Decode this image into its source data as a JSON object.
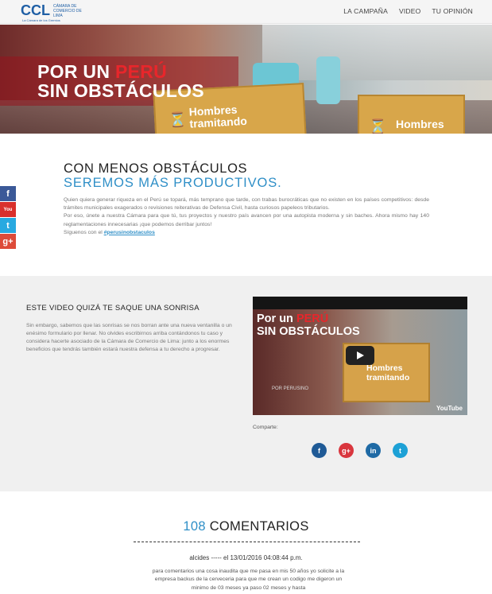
{
  "header": {
    "logo_text": "CCL",
    "logo_org": "CÁMARA DE COMERCIO DE LIMA",
    "logo_tagline": "La Cámara de los Gremios",
    "nav": [
      {
        "label": "LA CAMPAÑA"
      },
      {
        "label": "VIDEO"
      },
      {
        "label": "TU OPINIÓN"
      }
    ]
  },
  "hero": {
    "title_line1_prefix": "POR UN ",
    "title_line1_highlight": "PERÚ",
    "title_line2": "SIN OBSTÁCULOS",
    "sign_left": "Hombres tramitando",
    "sign_right": "Hombres"
  },
  "social_sidebar": [
    {
      "name": "facebook",
      "glyph": "f",
      "color": "#3b5998"
    },
    {
      "name": "youtube",
      "glyph": "You",
      "color": "#d9302c"
    },
    {
      "name": "twitter",
      "glyph": "t",
      "color": "#28a9e0"
    },
    {
      "name": "google-plus",
      "glyph": "g+",
      "color": "#dd4b39"
    }
  ],
  "intro": {
    "heading_line1": "CON MENOS OBSTÁCULOS",
    "heading_line2": "SEREMOS MÁS PRODUCTIVOS.",
    "paragraph1": "Quien quiera generar riqueza en el Perú se topará, más temprano que tarde, con trabas burocráticas que no existen en los países competitivos: desde trámites municipales exagerados o revisiones reiterativas de Defensa Civil, hasta curiosos papeleos tributarios.",
    "paragraph2": "Por eso, únete a nuestra Cámara para que tú, tus proyectos y nuestro país avancen por una autopista moderna y sin baches. Ahora mismo hay 140 reglamentaciones innecesarias ¡que podemos derribar juntos!",
    "follow_prefix": "Síguenos con el ",
    "hashtag": "#perusinobstaculos"
  },
  "video_section": {
    "heading": "ESTE VIDEO QUIZÁ TE SAQUE UNA SONRISA",
    "description": "Sin embargo, sabemos que las sonrisas se nos borran ante una nueva ventanilla o un enésimo formulario por llenar. No olvides escribirnos arriba contándonos tu caso y considera hacerte asociado de la Cámara de Comercio de Lima: junto a los enormes beneficios que tendrás también estará nuestra defensa a tu derecho a progresar.",
    "player": {
      "title_line1_prefix": "Por un ",
      "title_line1_highlight": "PERÚ",
      "title_line2": "SIN OBSTÁCULOS",
      "sign_label": "Hombres tramitando",
      "brand": "POR PERUSINO",
      "youtube_label": "YouTube"
    },
    "share_label": "Comparte:",
    "share_buttons": [
      {
        "name": "facebook",
        "glyph": "f",
        "color": "#1f5a96"
      },
      {
        "name": "google-plus",
        "glyph": "g+",
        "color": "#d9363e"
      },
      {
        "name": "linkedin",
        "glyph": "in",
        "color": "#1f6aa5"
      },
      {
        "name": "twitter",
        "glyph": "t",
        "color": "#1da1d6"
      }
    ]
  },
  "comments": {
    "count": "108",
    "label": "COMENTARIOS",
    "items": [
      {
        "meta": "alcides ----- el 13/01/2016 04:08:44 p.m.",
        "text": "para comentarios una cosa inaudita que me pasa en mis 50 años yo solicite a la empresa backus de la cerveceria para que me crean un codigo me digeron un minimo de 03 meses ya paso 02 meses y hasta"
      }
    ]
  }
}
